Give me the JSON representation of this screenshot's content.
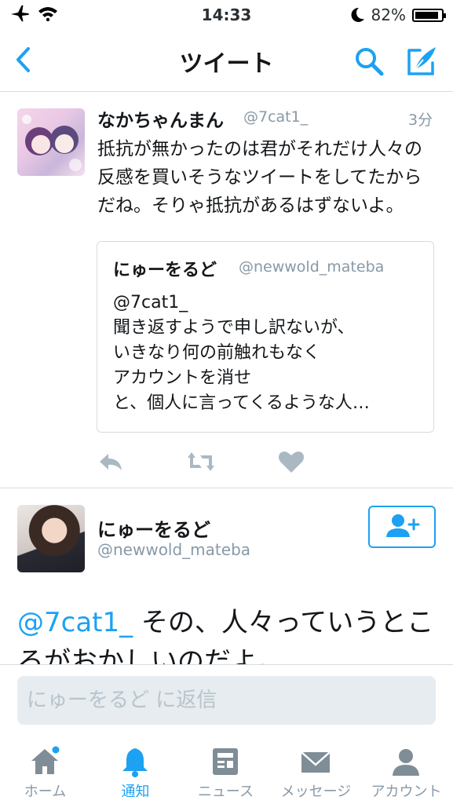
{
  "status": {
    "time": "14:33",
    "battery": "82%"
  },
  "nav": {
    "title": "ツイート"
  },
  "tweet": {
    "name": "なかちゃんまん",
    "handle": "@7cat1_",
    "time": "3分",
    "body": "抵抗が無かったのは君がそれだけ人々の反感を買いそうなツイートをしてたからだね。そりゃ抵抗があるはずないよ。",
    "quote": {
      "name": "にゅーをるど",
      "handle": "@newwold_mateba",
      "body": "@7cat1_\n聞き返すようで申し訳ないが、\nいきなり何の前触れもなく\nアカウントを消せ\nと、個人に言ってくるような人…"
    }
  },
  "main_tweet": {
    "name": "にゅーをるど",
    "handle": "@newwold_mateba",
    "mention": "@7cat1_",
    "text": " その、人々っていうところがおかしいのだよ。"
  },
  "reply": {
    "placeholder": "にゅーをるど に返信"
  },
  "tabs": [
    {
      "label": "ホーム",
      "icon": "home-icon"
    },
    {
      "label": "通知",
      "icon": "bell-icon"
    },
    {
      "label": "ニュース",
      "icon": "news-icon"
    },
    {
      "label": "メッセージ",
      "icon": "envelope-icon"
    },
    {
      "label": "アカウント",
      "icon": "person-icon"
    }
  ],
  "colors": {
    "accent": "#1da1f2",
    "muted": "#8899a6",
    "text": "#14171a",
    "icon_gray": "#7f8d97"
  }
}
